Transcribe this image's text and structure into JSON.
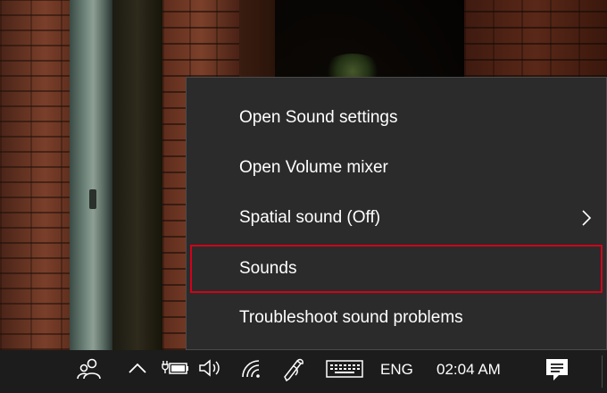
{
  "context_menu": {
    "items": [
      {
        "label": "Open Sound settings"
      },
      {
        "label": "Open Volume mixer"
      },
      {
        "label": "Spatial sound (Off)"
      },
      {
        "label": "Sounds"
      },
      {
        "label": "Troubleshoot sound problems"
      }
    ],
    "highlighted_item": "Sounds",
    "highlight_color": "#d0021b",
    "background_color": "#2b2b2b"
  },
  "taskbar": {
    "icons": [
      "people-icon",
      "chevron-up-icon",
      "battery-plug-icon",
      "speaker-icon",
      "wifi-icon",
      "pen-icon",
      "keyboard-icon",
      "notification-icon"
    ],
    "language": "ENG",
    "time": "02:04 AM"
  }
}
